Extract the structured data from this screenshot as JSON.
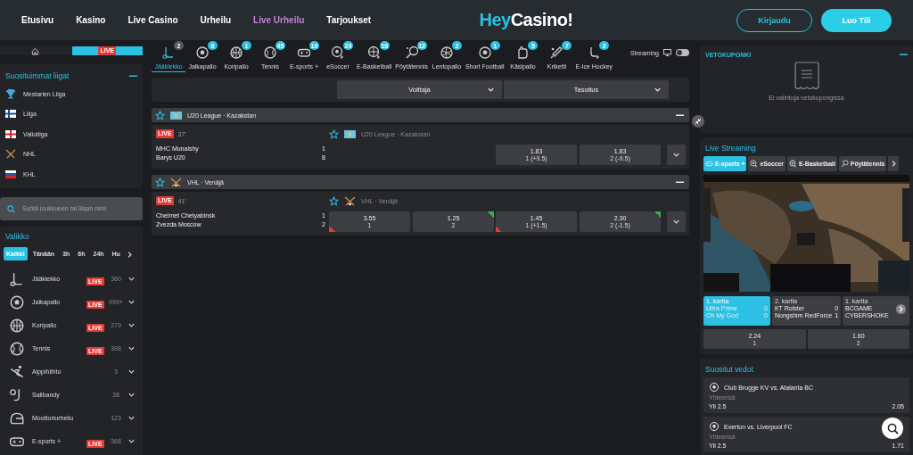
{
  "nav": {
    "links": [
      {
        "label": "Etusivu",
        "selected": false
      },
      {
        "label": "Kasino",
        "selected": false
      },
      {
        "label": "Live Casino",
        "selected": false
      },
      {
        "label": "Urheilu",
        "selected": false
      },
      {
        "label": "Live Urheilu",
        "selected": true
      },
      {
        "label": "Tarjoukset",
        "selected": false
      }
    ],
    "logo": {
      "first": "Hey",
      "second": "Casino!"
    },
    "login": "Kirjaudu",
    "signup": "Luo Tili"
  },
  "sidebar": {
    "mode_tabs": [
      {
        "kind": "home",
        "selected": false
      },
      {
        "kind": "live",
        "label": "LIVE",
        "selected": true
      }
    ],
    "popular": {
      "title": "Suosituimmat liigat",
      "items": [
        {
          "label": "Mestarien Liiga"
        },
        {
          "label": "Liiga"
        },
        {
          "label": "Valioliiga"
        },
        {
          "label": "NHL"
        },
        {
          "label": "KHL"
        }
      ]
    },
    "search": {
      "placeholder": "Syötä joukkueen tai liigan nimi"
    },
    "menu": {
      "title": "Valikko",
      "filters": [
        {
          "label": "Kaikki",
          "selected": true
        },
        {
          "label": "Tänään",
          "selected": false
        },
        {
          "label": "3h",
          "selected": false
        },
        {
          "label": "6h",
          "selected": false
        },
        {
          "label": "24h",
          "selected": false
        },
        {
          "label": "Hu",
          "selected": false
        }
      ],
      "sports": [
        {
          "label": "Jääkiekko",
          "badge": "LIVE",
          "count": "360"
        },
        {
          "label": "Jalkapallo",
          "badge": "LIVE",
          "count": "999+"
        },
        {
          "label": "Koripallo",
          "badge": "LIVE",
          "count": "279"
        },
        {
          "label": "Tennis",
          "badge": "LIVE",
          "count": "398"
        },
        {
          "label": "Alppihiihto",
          "count": "3"
        },
        {
          "label": "Salibandy",
          "count": "38"
        },
        {
          "label": "Moottoriurheilu",
          "count": "123"
        },
        {
          "label": "E-sports +",
          "badge": "LIVE",
          "count": "368"
        }
      ]
    }
  },
  "sport_tabs": [
    {
      "label": "Jääkiekko",
      "count": "2",
      "selected": true
    },
    {
      "label": "Jalkapallo",
      "count": "8",
      "selected": false
    },
    {
      "label": "Koripallo",
      "count": "1",
      "selected": false
    },
    {
      "label": "Tennis",
      "count": "45",
      "selected": false
    },
    {
      "label": "E-sports +",
      "count": "10",
      "selected": false
    },
    {
      "label": "eSoccer",
      "count": "24",
      "selected": false
    },
    {
      "label": "E-Basketball",
      "count": "18",
      "selected": false
    },
    {
      "label": "Pöytätennis",
      "count": "12",
      "selected": false
    },
    {
      "label": "Lentopallo",
      "count": "2",
      "selected": false
    },
    {
      "label": "Short Football",
      "count": "1",
      "selected": false
    },
    {
      "label": "Käsipallo",
      "count": "5",
      "selected": false
    },
    {
      "label": "Kriketti",
      "count": "7",
      "selected": false
    },
    {
      "label": "E-Ice Hockey",
      "count": "2",
      "selected": false
    }
  ],
  "streaming": {
    "label": "Streaming",
    "on": false
  },
  "markets": [
    "Voittaja",
    "Tasoitus"
  ],
  "leagues": [
    {
      "name": "U20 League · Kazakstan",
      "matches": [
        {
          "badge": "LIVE",
          "time": "37'",
          "league": "U20 League · Kazakstan",
          "teams": [
            {
              "name": "MHC Munaishy",
              "score": "1"
            },
            {
              "name": "Barys U20",
              "score": "8"
            }
          ],
          "handicap_odds": [
            {
              "value": "1.83",
              "label": "1 (+9.5)"
            },
            {
              "value": "1.83",
              "label": "2 (-9.5)"
            }
          ]
        }
      ]
    },
    {
      "name": "VHL · Venäjä",
      "matches": [
        {
          "badge": "LIVE",
          "time": "41'",
          "league": "VHL · Venäjä",
          "teams": [
            {
              "name": "Chelmet Chelyabinsk",
              "score": "1"
            },
            {
              "name": "Zvezda Moscow",
              "score": "2"
            }
          ],
          "winner_odds": [
            {
              "value": "3.55",
              "label": "1",
              "rising": false
            },
            {
              "value": "1.25",
              "label": "2",
              "rising": true
            }
          ],
          "handicap_odds": [
            {
              "value": "1.45",
              "label": "1 (+1.5)",
              "rising": false
            },
            {
              "value": "2.30",
              "label": "2 (-1.5)",
              "rising": true
            }
          ]
        }
      ]
    }
  ],
  "betslip": {
    "title": "VETOKUPONKI",
    "empty": "Ei valintoja vetokupongissa"
  },
  "live_streaming": {
    "title": "Live Streaming",
    "tabs": [
      {
        "label": "E-sports +",
        "selected": true
      },
      {
        "label": "eSoccer",
        "selected": false
      },
      {
        "label": "E-Basketball",
        "selected": false
      },
      {
        "label": "Pöytätennis",
        "selected": false
      }
    ],
    "matches": [
      {
        "map": "1. kartta",
        "selected": true,
        "teams": [
          {
            "name": "Ultra Prime",
            "score": "0"
          },
          {
            "name": "Oh My God",
            "score": "0"
          }
        ]
      },
      {
        "map": "2. kartta",
        "selected": false,
        "teams": [
          {
            "name": "KT Rolster",
            "score": "0"
          },
          {
            "name": "Nongshim RedForce",
            "score": "1"
          }
        ]
      },
      {
        "map": "1. kartta",
        "selected": false,
        "teams": [
          {
            "name": "BCGAME"
          },
          {
            "name": "CYBERSHOKE"
          }
        ]
      }
    ],
    "odds": [
      {
        "value": "2.24",
        "label": "1"
      },
      {
        "value": "1.60",
        "label": "2"
      }
    ]
  },
  "popular_bets": {
    "title": "Suositut vedot",
    "items": [
      {
        "match": "Club Brugge KV vs. Atalanta BC",
        "market": "Yhteensä",
        "selection": "Yli 2.5",
        "odds": "2.05"
      },
      {
        "match": "Everton vs. Liverpool FC",
        "market": "Yhteensä",
        "selection": "Yli 2.5",
        "odds": "1.71"
      }
    ]
  }
}
